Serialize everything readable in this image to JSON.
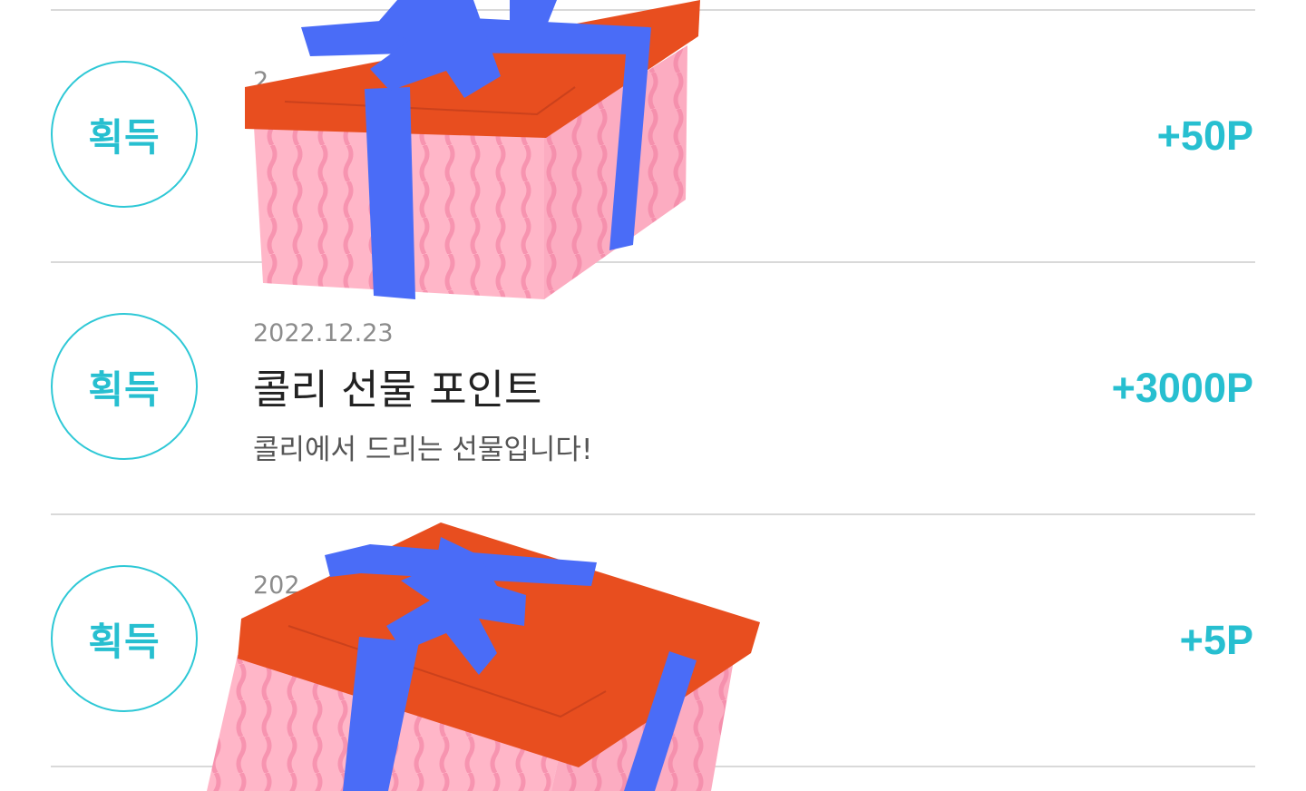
{
  "rows": [
    {
      "badge": "획득",
      "date": "2",
      "title": "",
      "desc": "!",
      "amount": "+50P"
    },
    {
      "badge": "획득",
      "date": "2022.12.23",
      "title": "콜리 선물 포인트",
      "desc": "콜리에서 드리는 선물입니다!",
      "amount": "+3000P"
    },
    {
      "badge": "획득",
      "date": "202",
      "title": "",
      "desc": "",
      "amount": "+5P"
    }
  ],
  "colors": {
    "accent": "#27bfd0",
    "divider": "#d9d9d9",
    "gift_lid": "#e84e1f",
    "gift_ribbon": "#4a6cf7",
    "gift_box": "#ffb6c8"
  },
  "icons": {
    "gift": "gift-box-icon"
  }
}
